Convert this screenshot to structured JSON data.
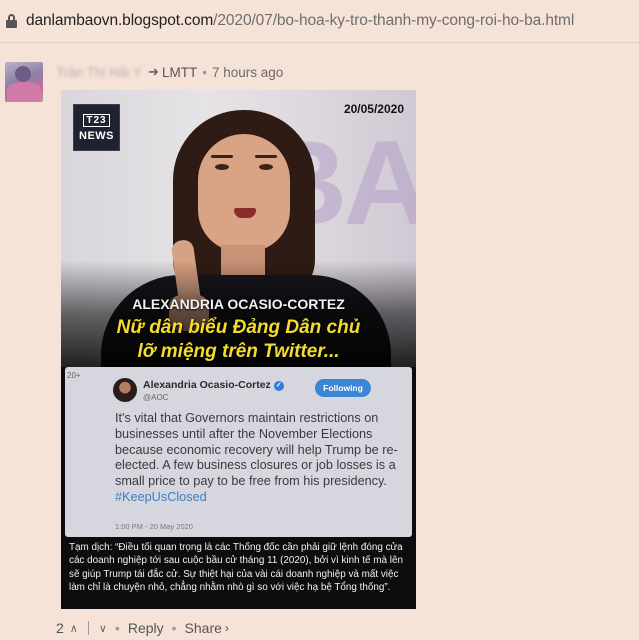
{
  "browser": {
    "url_domain": "danlambaovn.blogspot.com",
    "url_path": "/2020/07/bo-hoa-ky-tro-thanh-my-cong-roi-ho-ba.html",
    "lock_icon": "lock-icon"
  },
  "comment": {
    "author": "Trần Thị Hải Y",
    "reply_arrow": "➜",
    "parent": "LMTT",
    "separator": "•",
    "time": "7 hours ago",
    "post": {
      "logo_line1": "T23",
      "logo_line2": "NEWS",
      "date": "20/05/2020",
      "background_text": "BA",
      "subject_name": "ALEXANDRIA OCASIO-CORTEZ",
      "headline_line1": "Nữ dân biểu Đảng Dân chủ",
      "headline_line2": "lỡ miệng trên Twitter...",
      "tweet": {
        "corner_label": "20+",
        "name": "Alexandria Ocasio-Cortez",
        "verified_mark": "✓",
        "handle": "@AOC",
        "follow_label": "Following",
        "text": "It's vital that Governors maintain restrictions on businesses until after the November Elections because economic recovery will help Trump be re-elected. A few business closures or job losses is a small price to pay to be free from his presidency. ",
        "hashtag": "#KeepUsClosed",
        "timestamp": "1:00 PM - 20 May 2020"
      },
      "caption": "Tạm dịch: “Điều tối quan trọng là các Thống đốc cần phải giữ lệnh đóng cửa các doanh nghiệp tới sau cuộc bầu cử tháng 11 (2020), bởi vì kinh tế mà lên sẽ giúp Trump tái đắc cử. Sự thiệt hại của vài cái doanh nghiệp và mất việc làm chỉ là chuyện nhỏ, chẳng nhằm nhò gì so với việc hạ bệ Tổng thống”."
    },
    "actions": {
      "vote_count": "2",
      "upvote_icon": "chevron-up-icon",
      "upvote_glyph": "∧",
      "downvote_icon": "chevron-down-icon",
      "downvote_glyph": "∨",
      "reply_label": "Reply",
      "dot": "•",
      "share_label": "Share",
      "share_glyph": "›"
    }
  },
  "colors": {
    "page_background": "#f6e3d7",
    "headline_yellow": "#f3dc2b",
    "hashtag_blue": "#3a7fc4"
  }
}
